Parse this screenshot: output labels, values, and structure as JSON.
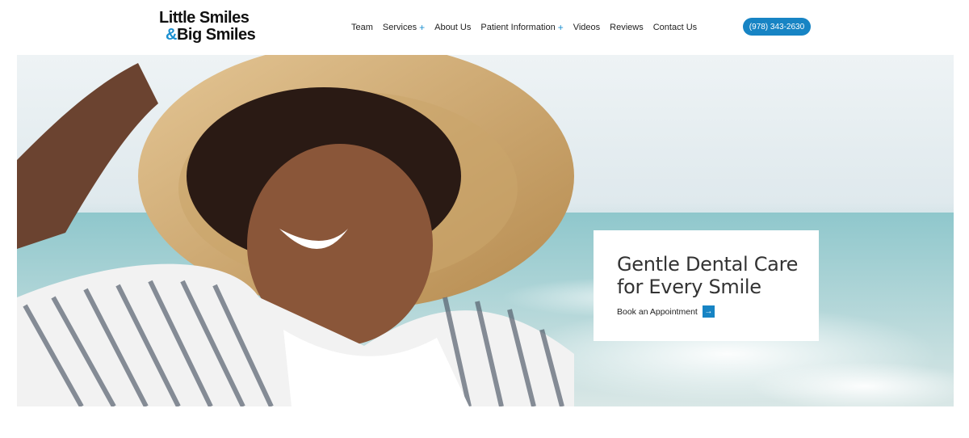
{
  "logo": {
    "line1": "Little Smiles",
    "amp": "&",
    "line2": "Big Smiles"
  },
  "nav": {
    "items": [
      {
        "label": "Team",
        "has_submenu": false
      },
      {
        "label": "Services",
        "has_submenu": true
      },
      {
        "label": "About Us",
        "has_submenu": false
      },
      {
        "label": "Patient Information",
        "has_submenu": true
      },
      {
        "label": "Videos",
        "has_submenu": false
      },
      {
        "label": "Reviews",
        "has_submenu": false
      },
      {
        "label": "Contact Us",
        "has_submenu": false
      }
    ],
    "submenu_symbol": "+"
  },
  "phone": {
    "label": "(978) 343-2630"
  },
  "hero": {
    "title": "Gentle Dental Care for Every Smile",
    "cta_label": "Book an Appointment",
    "cta_icon": "arrow-right-icon"
  },
  "colors": {
    "accent": "#1784c4",
    "logo_amp": "#1a8fd0",
    "card_bg": "#ffffff"
  }
}
